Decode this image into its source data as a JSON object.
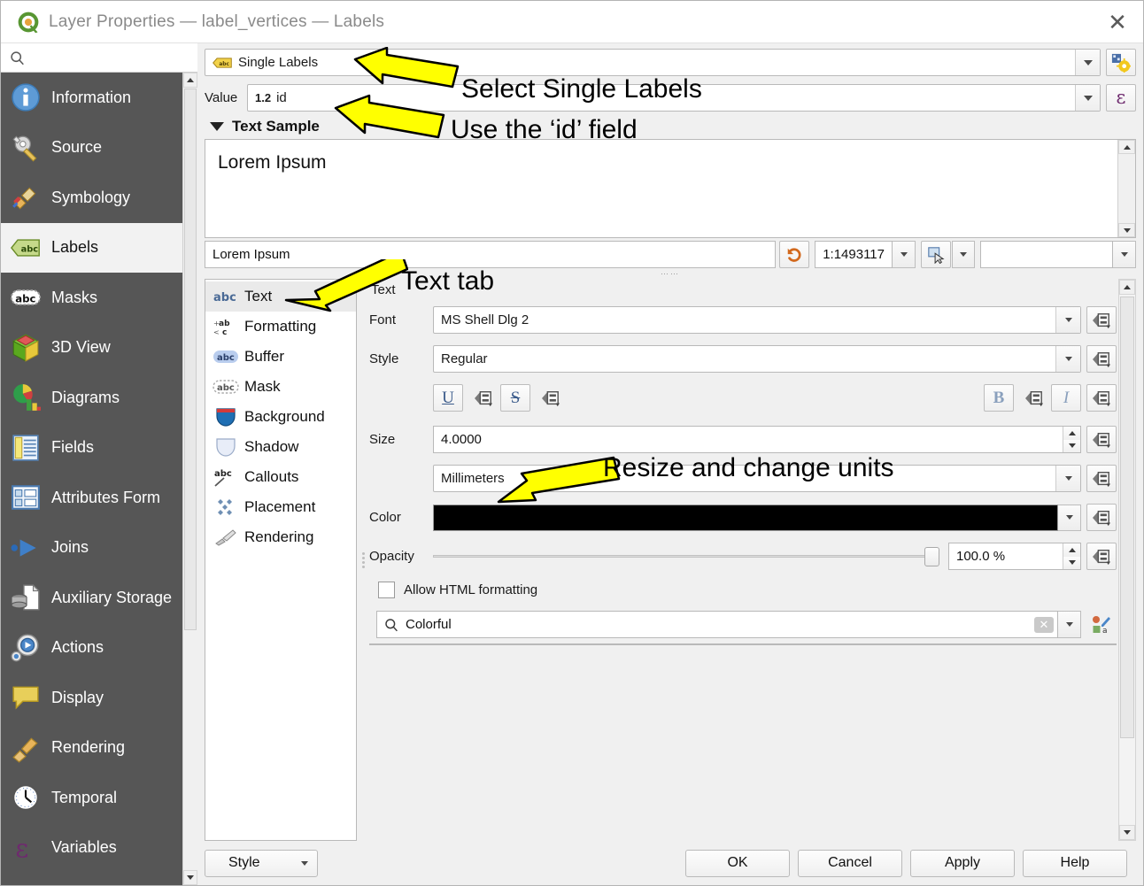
{
  "window": {
    "title": "Layer Properties — label_vertices — Labels",
    "close_label": "✕",
    "app_icon": "qgis-logo-icon"
  },
  "sidebar": {
    "search_placeholder": "",
    "search_value": "",
    "items": [
      {
        "label": "Information",
        "icon": "information-icon",
        "selected": false
      },
      {
        "label": "Source",
        "icon": "source-icon",
        "selected": false
      },
      {
        "label": "Symbology",
        "icon": "symbology-icon",
        "selected": false
      },
      {
        "label": "Labels",
        "icon": "labels-icon",
        "selected": true
      },
      {
        "label": "Masks",
        "icon": "masks-icon",
        "selected": false
      },
      {
        "label": "3D View",
        "icon": "3d-view-icon",
        "selected": false
      },
      {
        "label": "Diagrams",
        "icon": "diagrams-icon",
        "selected": false
      },
      {
        "label": "Fields",
        "icon": "fields-icon",
        "selected": false
      },
      {
        "label": "Attributes Form",
        "icon": "attributes-form-icon",
        "selected": false
      },
      {
        "label": "Joins",
        "icon": "joins-icon",
        "selected": false
      },
      {
        "label": "Auxiliary Storage",
        "icon": "auxiliary-storage-icon",
        "selected": false
      },
      {
        "label": "Actions",
        "icon": "actions-icon",
        "selected": false
      },
      {
        "label": "Display",
        "icon": "display-icon",
        "selected": false
      },
      {
        "label": "Rendering",
        "icon": "rendering-icon",
        "selected": false
      },
      {
        "label": "Temporal",
        "icon": "temporal-icon",
        "selected": false
      },
      {
        "label": "Variables",
        "icon": "variables-icon",
        "selected": false
      }
    ]
  },
  "labeling": {
    "mode_value": "Single Labels",
    "mode_icon": "label-abc-icon",
    "settings_button_icon": "automated-placement-icon",
    "value_label": "Value",
    "value_field": "id",
    "value_field_type": "1.2",
    "value_expression_icon": "epsilon-expression-icon"
  },
  "text_sample": {
    "section_title": "Text Sample",
    "preview_text": "Lorem Ipsum",
    "input_value": "Lorem Ipsum",
    "revert_icon": "revert-arrow-icon",
    "scale": "1:1493117",
    "map_icon": "select-map-icon",
    "background_value": ""
  },
  "tabs": [
    {
      "label": "Text",
      "icon": "text-abc-icon",
      "selected": true
    },
    {
      "label": "Formatting",
      "icon": "formatting-icon",
      "selected": false
    },
    {
      "label": "Buffer",
      "icon": "buffer-abc-icon",
      "selected": false
    },
    {
      "label": "Mask",
      "icon": "mask-abc-icon",
      "selected": false
    },
    {
      "label": "Background",
      "icon": "background-shield-icon",
      "selected": false
    },
    {
      "label": "Shadow",
      "icon": "shadow-shield-icon",
      "selected": false
    },
    {
      "label": "Callouts",
      "icon": "callouts-icon",
      "selected": false
    },
    {
      "label": "Placement",
      "icon": "placement-icon",
      "selected": false
    },
    {
      "label": "Rendering",
      "icon": "rendering-brush-icon",
      "selected": false
    }
  ],
  "text_form": {
    "group_title": "Text",
    "font_label": "Font",
    "font_value": "MS Shell Dlg 2",
    "style_label": "Style",
    "style_value": "Regular",
    "underline_label": "U",
    "strikethrough_label": "S",
    "bold_label": "B",
    "italic_label": "I",
    "size_label": "Size",
    "size_value": "4.0000",
    "units_value": "Millimeters",
    "color_label": "Color",
    "color_value": "#000000",
    "opacity_label": "Opacity",
    "opacity_value": "100.0 %",
    "opacity_percent": 100,
    "allow_html_label": "Allow HTML formatting",
    "allow_html_checked": false,
    "style_search_value": "Colorful",
    "style_search_icon": "search-icon",
    "clear_icon": "clear-x-icon",
    "save_style_icon": "save-style-icon",
    "dd_override_icon": "data-defined-override-icon"
  },
  "footer": {
    "style_label": "Style",
    "ok_label": "OK",
    "cancel_label": "Cancel",
    "apply_label": "Apply",
    "help_label": "Help"
  },
  "annotations": [
    {
      "text": "Select Single Labels"
    },
    {
      "text": "Use the ‘id’ field"
    },
    {
      "text": "Text tab"
    },
    {
      "text": "Resize and change units"
    }
  ],
  "colors": {
    "sidebar_bg": "#565656",
    "annotation_arrow": "#ffff00",
    "selected_nav_bg": "#f2f2f2"
  }
}
